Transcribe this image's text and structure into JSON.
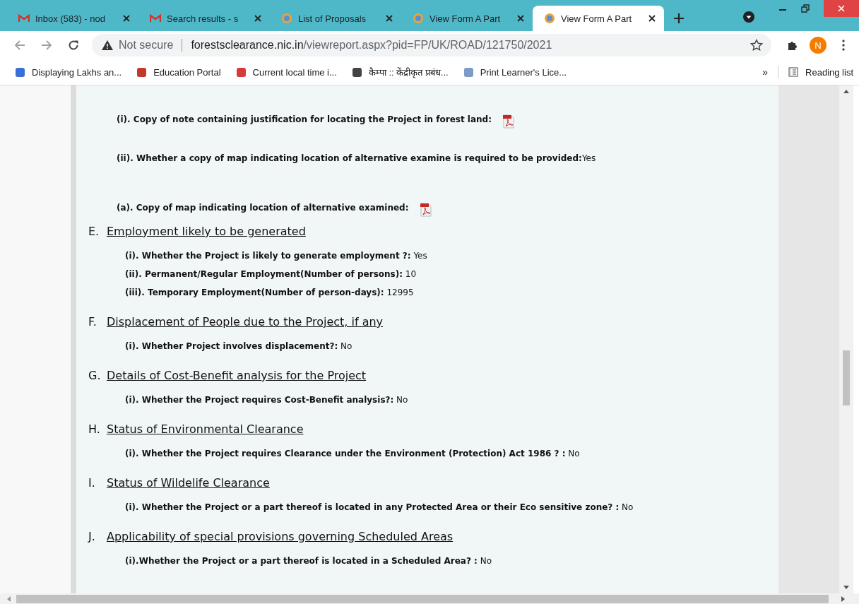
{
  "tabs": [
    {
      "title": "Inbox (583) - nod",
      "kind": "mail",
      "selected": false
    },
    {
      "title": "Search results - s",
      "kind": "mail",
      "selected": false
    },
    {
      "title": "List of Proposals",
      "kind": "site",
      "selected": false
    },
    {
      "title": "View Form A Part",
      "kind": "site",
      "selected": false
    },
    {
      "title": "View Form A Part",
      "kind": "site",
      "selected": true
    }
  ],
  "address_bar": {
    "security": "Not secure",
    "url_host": "forestsclearance.nic.in",
    "url_path": "/viewreport.aspx?pid=FP/UK/ROAD/121750/2021"
  },
  "profile_initial": "N",
  "bookmarks": [
    {
      "title": "Displaying Lakhs an...",
      "color": "#3b6fd8"
    },
    {
      "title": "Education Portal",
      "color": "#c0392b"
    },
    {
      "title": "Current local time i...",
      "color": "#d63a3a"
    },
    {
      "title": "कैम्पा :: केंद्रीकृत प्रबंध...",
      "color": "#444444"
    },
    {
      "title": "Print Learner's Lice...",
      "color": "#7a9cc6"
    }
  ],
  "bookmarks_overflow": "»",
  "reading_list": "Reading list",
  "intro_items": [
    {
      "label": "(i). Copy of note containing justification for locating the Project in forest land:",
      "attachment": true
    },
    {
      "label": "(ii). Whether a copy of map indicating location of alternative examine is required to be provided:",
      "value": "Yes",
      "attachment": false
    },
    {
      "label": "(a). Copy of map indicating location of alternative examined:",
      "attachment": true
    }
  ],
  "sections": [
    {
      "letter": "E.",
      "title": "Employment likely to be generated",
      "items": [
        {
          "label": "(i). Whether the Project is likely to generate employment ?:",
          "value": "Yes"
        },
        {
          "label": "(ii). Permanent/Regular Employment(Number of persons):",
          "value": "10"
        },
        {
          "label": "(iii). Temporary Employment(Number of person-days):",
          "value": "12995"
        }
      ]
    },
    {
      "letter": "F.",
      "title": "Displacement of People due to the Project, if any",
      "items": [
        {
          "label": "(i). Whether Project involves displacement?:",
          "value": "No"
        }
      ]
    },
    {
      "letter": "G.",
      "title": "Details of Cost-Benefit analysis for the Project",
      "items": [
        {
          "label": "(i). Whether the Project requires Cost-Benefit analysis?:",
          "value": "No"
        }
      ]
    },
    {
      "letter": "H.",
      "title": "Status of Environmental Clearance",
      "items": [
        {
          "label": "(i). Whether the Project requires Clearance under the Environment (Protection) Act 1986 ? :",
          "value": "No"
        }
      ]
    },
    {
      "letter": "I.",
      "title": "Status of Wildelife Clearance",
      "items": [
        {
          "label": "(i). Whether the Project or a part thereof is located in any Protected Area or their Eco sensitive zone? :",
          "value": "No"
        }
      ]
    },
    {
      "letter": "J.",
      "title": "Applicability of special provisions governing Scheduled Areas",
      "items": [
        {
          "label": "(i).Whether the Project or a part thereof is located in a Scheduled Area? :",
          "value": "No"
        }
      ]
    }
  ]
}
